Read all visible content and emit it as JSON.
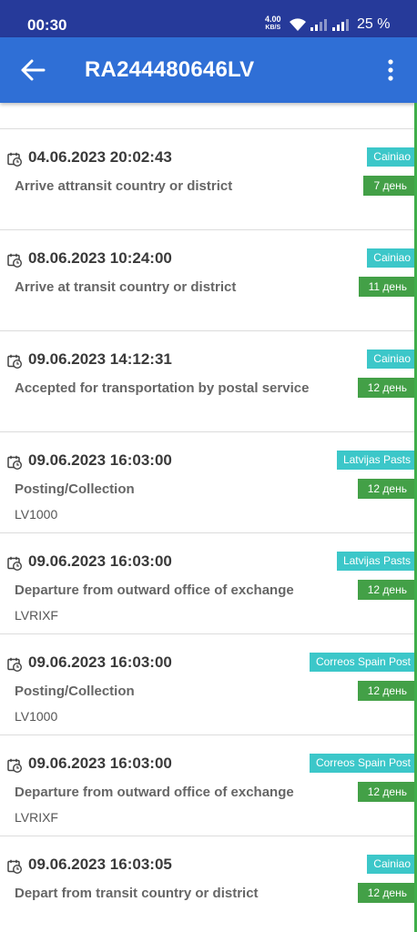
{
  "status_bar": {
    "time": "00:30",
    "speed_value": "4.00",
    "speed_unit": "KB/S",
    "battery": "25 %"
  },
  "app_bar": {
    "title": "RA244480646LV",
    "back_icon": "arrow-left-icon",
    "menu_icon": "more-vert-icon",
    "background": "#2f6fd6"
  },
  "colors": {
    "status_bar": "#263a9a",
    "carrier_badge": "#3cc7c9",
    "days_badge": "#43a047",
    "timeline_line": "#3fae4a"
  },
  "events": [
    {
      "datetime": "04.06.2023 20:02:43",
      "status": "Arrive attransit country or district",
      "location": "",
      "carrier": "Cainiao",
      "days": "7 день"
    },
    {
      "datetime": "08.06.2023 10:24:00",
      "status": "Arrive at transit country or district",
      "location": "",
      "carrier": "Cainiao",
      "days": "11 день"
    },
    {
      "datetime": "09.06.2023 14:12:31",
      "status": "Accepted for transportation by postal service",
      "location": "",
      "carrier": "Cainiao",
      "days": "12 день"
    },
    {
      "datetime": "09.06.2023 16:03:00",
      "status": "Posting/Collection",
      "location": "LV1000",
      "carrier": "Latvijas Pasts",
      "days": "12 день"
    },
    {
      "datetime": "09.06.2023 16:03:00",
      "status": "Departure from outward office of exchange",
      "location": "LVRIXF",
      "carrier": "Latvijas Pasts",
      "days": "12 день"
    },
    {
      "datetime": "09.06.2023 16:03:00",
      "status": "Posting/Collection",
      "location": "LV1000",
      "carrier": "Correos Spain Post",
      "days": "12 день"
    },
    {
      "datetime": "09.06.2023 16:03:00",
      "status": "Departure from outward office of exchange",
      "location": "LVRIXF",
      "carrier": "Correos Spain Post",
      "days": "12 день"
    },
    {
      "datetime": "09.06.2023 16:03:05",
      "status": "Depart from transit country or district",
      "location": "",
      "carrier": "Cainiao",
      "days": "12 день"
    }
  ]
}
